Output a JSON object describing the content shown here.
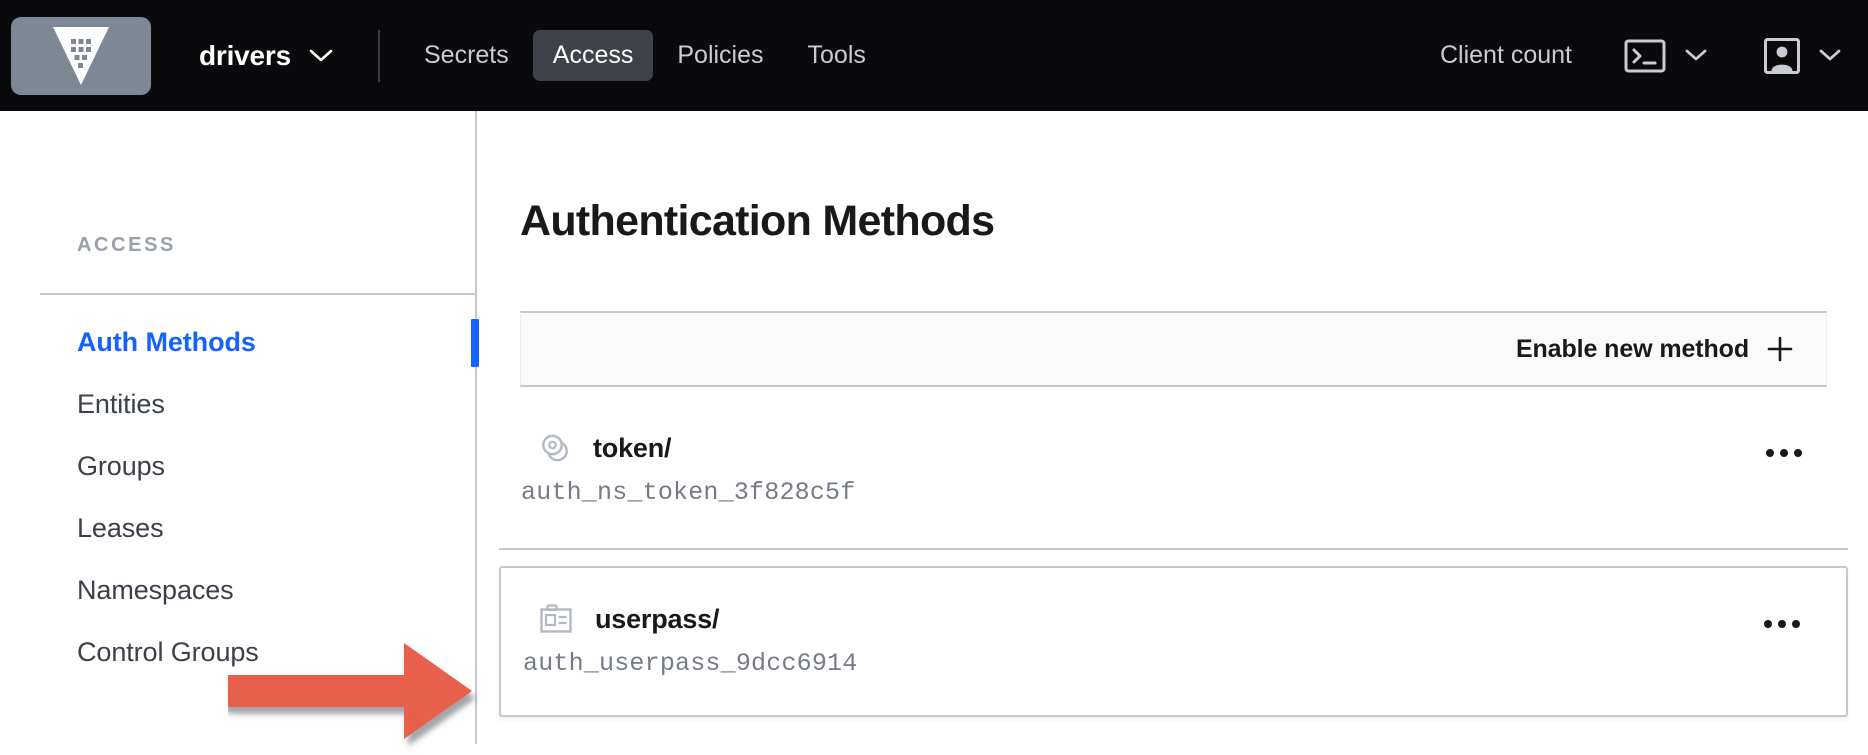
{
  "topnav": {
    "logo_icon": "vault-logo-icon",
    "namespace": "drivers",
    "namespace_chevron_icon": "chevron-down-icon",
    "tabs": [
      {
        "label": "Secrets",
        "active": false
      },
      {
        "label": "Access",
        "active": true
      },
      {
        "label": "Policies",
        "active": false
      },
      {
        "label": "Tools",
        "active": false
      }
    ],
    "client_count_label": "Client count",
    "console_icon": "terminal-icon",
    "console_chevron_icon": "chevron-down-icon",
    "user_icon": "user-avatar-icon",
    "user_chevron_icon": "chevron-down-icon"
  },
  "sidebar": {
    "section_label": "ACCESS",
    "items": [
      {
        "label": "Auth Methods",
        "active": true
      },
      {
        "label": "Entities",
        "active": false
      },
      {
        "label": "Groups",
        "active": false
      },
      {
        "label": "Leases",
        "active": false
      },
      {
        "label": "Namespaces",
        "active": false
      },
      {
        "label": "Control Groups",
        "active": false
      }
    ]
  },
  "main": {
    "page_title": "Authentication Methods",
    "toolbar": {
      "enable_label": "Enable new method",
      "plus_icon": "plus-icon"
    },
    "methods": [
      {
        "name": "token/",
        "path": "auth_ns_token_3f828c5f",
        "icon": "token-coins-icon",
        "menu_icon": "more-horizontal-icon"
      },
      {
        "name": "userpass/",
        "path": "auth_userpass_9dcc6914",
        "icon": "id-badge-icon",
        "menu_icon": "more-horizontal-icon"
      }
    ]
  },
  "annotation": {
    "arrow_color": "#e8604c",
    "arrow_direction": "right",
    "points_at": "userpass/"
  },
  "colors": {
    "nav_background": "#0a0a0c",
    "accent_blue": "#1563ff",
    "logo_tile": "#7d8795",
    "border_gray": "#c2c7d0",
    "muted_text": "#767b85"
  }
}
